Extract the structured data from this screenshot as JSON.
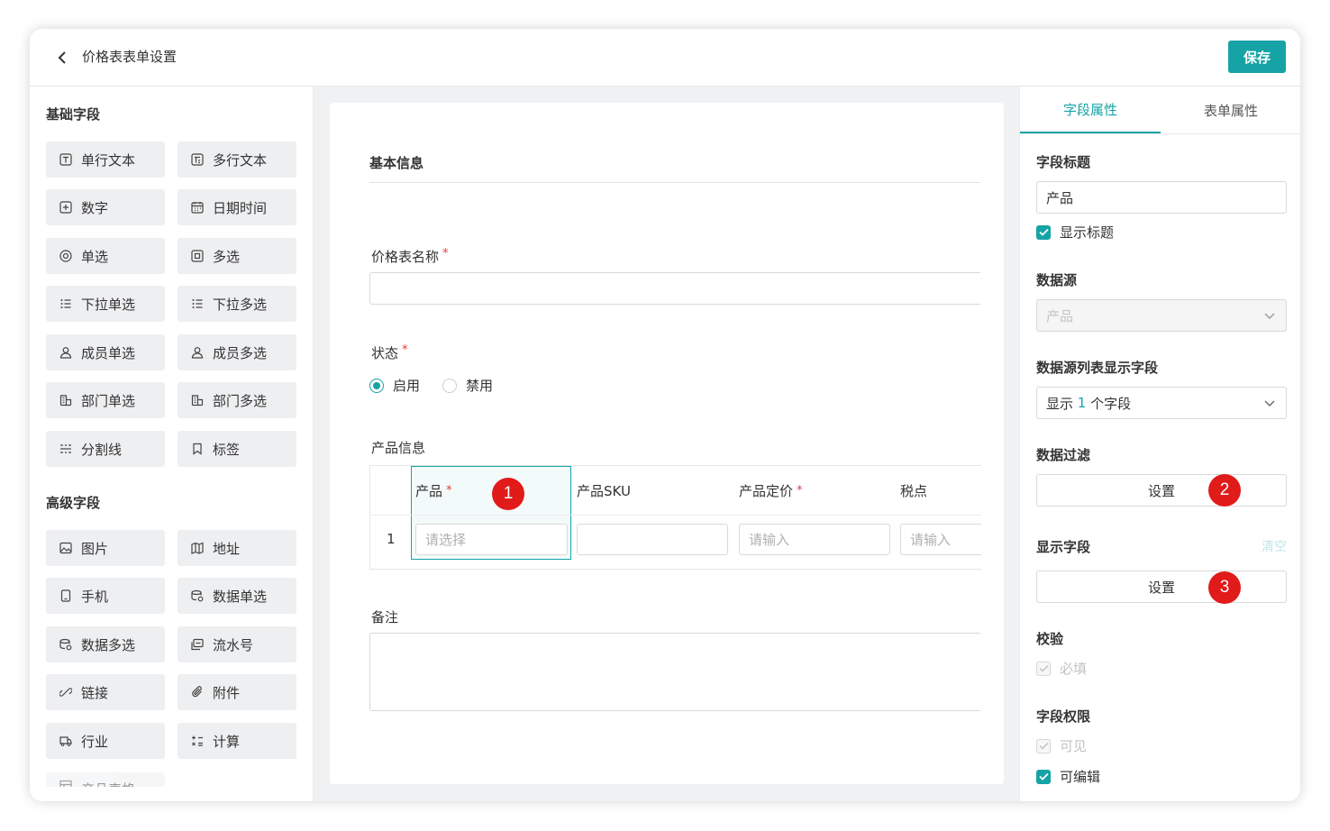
{
  "header": {
    "title": "价格表表单设置",
    "save_label": "保存"
  },
  "left": {
    "basic_title": "基础字段",
    "basic_fields": [
      {
        "label": "单行文本",
        "icon": "text-icon"
      },
      {
        "label": "多行文本",
        "icon": "multiline-text-icon"
      },
      {
        "label": "数字",
        "icon": "number-icon"
      },
      {
        "label": "日期时间",
        "icon": "calendar-icon"
      },
      {
        "label": "单选",
        "icon": "radio-icon"
      },
      {
        "label": "多选",
        "icon": "checkbox-icon"
      },
      {
        "label": "下拉单选",
        "icon": "list-icon"
      },
      {
        "label": "下拉多选",
        "icon": "list-icon"
      },
      {
        "label": "成员单选",
        "icon": "user-icon"
      },
      {
        "label": "成员多选",
        "icon": "user-icon"
      },
      {
        "label": "部门单选",
        "icon": "department-icon"
      },
      {
        "label": "部门多选",
        "icon": "department-icon"
      },
      {
        "label": "分割线",
        "icon": "divider-icon"
      },
      {
        "label": "标签",
        "icon": "bookmark-icon"
      }
    ],
    "advanced_title": "高级字段",
    "advanced_fields": [
      {
        "label": "图片",
        "icon": "image-icon"
      },
      {
        "label": "地址",
        "icon": "map-icon"
      },
      {
        "label": "手机",
        "icon": "phone-icon"
      },
      {
        "label": "数据单选",
        "icon": "database-icon"
      },
      {
        "label": "数据多选",
        "icon": "database-icon"
      },
      {
        "label": "流水号",
        "icon": "serial-number-icon"
      },
      {
        "label": "链接",
        "icon": "link-icon"
      },
      {
        "label": "附件",
        "icon": "paperclip-icon"
      },
      {
        "label": "行业",
        "icon": "truck-icon"
      },
      {
        "label": "计算",
        "icon": "calculator-icon"
      },
      {
        "label": "产品表格",
        "icon": "table-icon"
      }
    ]
  },
  "form": {
    "section_title": "基本信息",
    "name_label": "价格表名称",
    "required_mark": "*",
    "status_label": "状态",
    "status_options": [
      "启用",
      "禁用"
    ],
    "status_selected": "启用",
    "product_info_label": "产品信息",
    "table": {
      "columns": [
        {
          "label": "产品",
          "required": true,
          "placeholder": "请选择"
        },
        {
          "label": "产品SKU",
          "required": false,
          "placeholder": ""
        },
        {
          "label": "产品定价",
          "required": true,
          "placeholder": "请输入"
        },
        {
          "label": "税点",
          "required": false,
          "placeholder": "请输入"
        }
      ],
      "row_index": "1"
    },
    "remark_label": "备注"
  },
  "markers": [
    "1",
    "2",
    "3"
  ],
  "right": {
    "tabs": [
      "字段属性",
      "表单属性"
    ],
    "active_tab": "字段属性",
    "field_title_label": "字段标题",
    "field_title_value": "产品",
    "show_title_label": "显示标题",
    "datasource_label": "数据源",
    "datasource_value": "产品",
    "list_fields_label": "数据源列表显示字段",
    "list_fields_prefix": "显示",
    "list_fields_count": "1",
    "list_fields_suffix": "个字段",
    "filter_label": "数据过滤",
    "filter_button": "设置",
    "display_fields_label": "显示字段",
    "clear_label": "清空",
    "display_fields_button": "设置",
    "validation_label": "校验",
    "required_check_label": "必填",
    "permission_label": "字段权限",
    "visible_label": "可见",
    "editable_label": "可编辑"
  },
  "colors": {
    "accent": "#16a3a6",
    "marker": "#e11a1a",
    "required": "#e83a3a"
  }
}
